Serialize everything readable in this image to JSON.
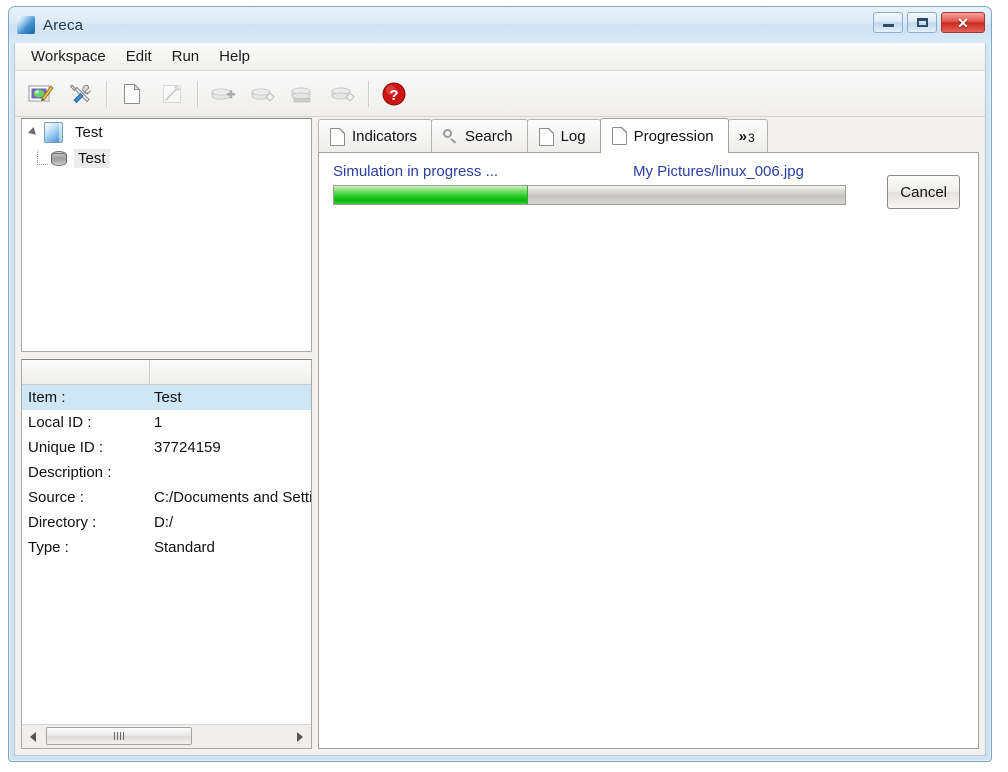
{
  "window": {
    "title": "Areca",
    "app_icon": "areca-app-icon",
    "controls": {
      "minimize": "minimize-button",
      "maximize": "maximize-button",
      "close": "close-button"
    }
  },
  "menubar": {
    "items": [
      {
        "label": "Workspace"
      },
      {
        "label": "Edit"
      },
      {
        "label": "Run"
      },
      {
        "label": "Help"
      }
    ]
  },
  "toolbar": {
    "buttons": [
      {
        "name": "open-workspace-icon",
        "enabled": true
      },
      {
        "name": "preferences-tools-icon",
        "enabled": true
      },
      {
        "name": "separator-1"
      },
      {
        "name": "new-target-icon",
        "enabled": true
      },
      {
        "name": "edit-target-icon",
        "enabled": false
      },
      {
        "name": "separator-2"
      },
      {
        "name": "backup-icon",
        "enabled": false
      },
      {
        "name": "simulate-backup-icon",
        "enabled": false
      },
      {
        "name": "merge-archives-icon",
        "enabled": false
      },
      {
        "name": "recover-archives-icon",
        "enabled": false
      },
      {
        "name": "separator-3"
      },
      {
        "name": "help-icon",
        "enabled": true
      }
    ]
  },
  "tree": {
    "root": {
      "label": "Test",
      "icon": "workspace-icon",
      "expanded": true
    },
    "child": {
      "label": "Test",
      "icon": "target-database-icon",
      "selected": true
    }
  },
  "properties": {
    "columns": [
      "",
      ""
    ],
    "rows": [
      {
        "key": "Item :",
        "value": "Test",
        "selected": true
      },
      {
        "key": "Local ID :",
        "value": "1",
        "selected": false
      },
      {
        "key": "Unique ID :",
        "value": "37724159",
        "selected": false
      },
      {
        "key": "Description :",
        "value": "",
        "selected": false
      },
      {
        "key": "Source :",
        "value": "C:/Documents and Settings",
        "selected": false
      },
      {
        "key": "Directory :",
        "value": "D:/",
        "selected": false
      },
      {
        "key": "Type :",
        "value": "Standard",
        "selected": false
      }
    ],
    "scrollbar": {
      "left_arrow": "scroll-left-arrow",
      "right_arrow": "scroll-right-arrow"
    }
  },
  "tabs": {
    "items": [
      {
        "label": "Indicators",
        "icon": "document-icon",
        "active": false
      },
      {
        "label": "Search",
        "icon": "search-icon",
        "active": false
      },
      {
        "label": "Log",
        "icon": "document-icon",
        "active": false
      },
      {
        "label": "Progression",
        "icon": "document-icon",
        "active": true
      }
    ],
    "overflow": {
      "chevron": "»",
      "count": "3"
    }
  },
  "progression": {
    "status": "Simulation in progress ...",
    "current_file": "My Pictures/linux_006.jpg",
    "percent": 38,
    "cancel_label": "Cancel"
  },
  "colors": {
    "link_text": "#2b3fa0",
    "progress_fill": "#0cbd0c",
    "selection": "#cfe6f7",
    "window_frame": "#cfe3f3"
  }
}
